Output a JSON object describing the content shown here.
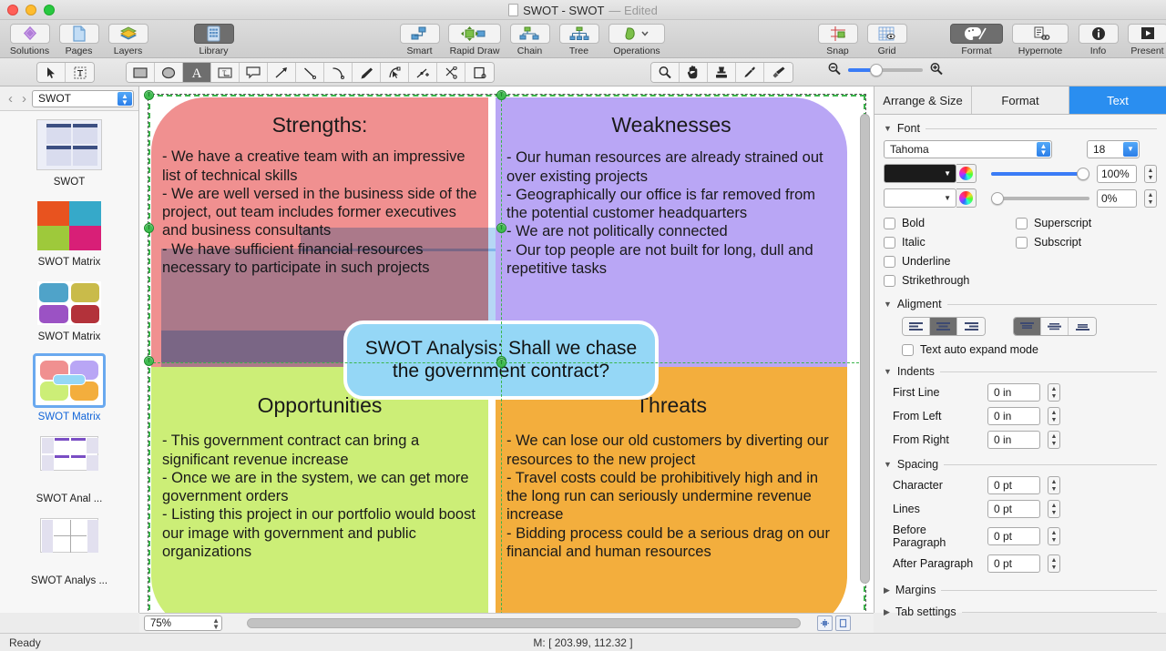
{
  "window": {
    "title": "SWOT - SWOT",
    "edited_label": "— Edited",
    "doc_icon": "document-icon"
  },
  "toolbar": {
    "left_group": [
      {
        "label": "Solutions",
        "icon": "solutions-diamond-icon",
        "selected": false
      },
      {
        "label": "Pages",
        "icon": "pages-icon",
        "selected": false
      },
      {
        "label": "Layers",
        "icon": "layers-icon",
        "selected": false
      }
    ],
    "library_group": [
      {
        "label": "Library",
        "icon": "library-grid-icon",
        "selected": true
      }
    ],
    "draw_group": [
      {
        "label": "Smart",
        "icon": "smart-connector-icon",
        "selected": false
      },
      {
        "label": "Rapid Draw",
        "icon": "rapid-draw-icon",
        "selected": false
      },
      {
        "label": "Chain",
        "icon": "chain-icon",
        "selected": false
      },
      {
        "label": "Tree",
        "icon": "tree-icon",
        "selected": false
      },
      {
        "label": "Operations",
        "icon": "operations-shape-icon",
        "selected": false
      }
    ],
    "view_group": [
      {
        "label": "Snap",
        "icon": "snap-icon",
        "selected": false
      },
      {
        "label": "Grid",
        "icon": "grid-icon",
        "selected": false
      }
    ],
    "right_group": [
      {
        "label": "Format",
        "icon": "format-palette-icon",
        "selected": true
      },
      {
        "label": "Hypernote",
        "icon": "hypernote-icon",
        "selected": false
      },
      {
        "label": "Info",
        "icon": "info-icon",
        "selected": false
      },
      {
        "label": "Present",
        "icon": "present-play-icon",
        "selected": false
      }
    ]
  },
  "toolstrip": {
    "select_tools": [
      {
        "icon": "pointer-arrow-icon",
        "selected": false
      },
      {
        "icon": "text-select-icon",
        "selected": false
      }
    ],
    "shape_tools": [
      {
        "icon": "rectangle-icon",
        "selected": false
      },
      {
        "icon": "ellipse-icon",
        "selected": false
      },
      {
        "icon": "text-tool-icon",
        "selected": true
      },
      {
        "icon": "text-field-icon",
        "selected": false
      },
      {
        "icon": "callout-icon",
        "selected": false
      },
      {
        "icon": "arrow-line-icon",
        "selected": false
      },
      {
        "icon": "line-icon",
        "selected": false
      },
      {
        "icon": "curve-icon",
        "selected": false
      },
      {
        "icon": "pen-icon",
        "selected": false
      },
      {
        "icon": "bezier-edit-icon",
        "selected": false
      },
      {
        "icon": "add-point-icon",
        "selected": false
      },
      {
        "icon": "scissors-cut-icon",
        "selected": false
      },
      {
        "icon": "crop-icon",
        "selected": false
      }
    ],
    "view_tools": [
      {
        "icon": "magnifier-icon",
        "selected": false
      },
      {
        "icon": "hand-pan-icon",
        "selected": false
      },
      {
        "icon": "stamp-icon",
        "selected": false
      },
      {
        "icon": "eyedropper-icon",
        "selected": false
      },
      {
        "icon": "paintbrush-icon",
        "selected": false
      }
    ],
    "zoom": {
      "out_icon": "zoom-out-icon",
      "in_icon": "zoom-in-icon",
      "value": 30
    }
  },
  "sidebar": {
    "prev_icon": "chevron-left-icon",
    "next_icon": "chevron-right-icon",
    "page_select_value": "SWOT",
    "pages": [
      {
        "label": "SWOT",
        "thumb": "swot-table-thumb",
        "active": false
      },
      {
        "label": "SWOT Matrix",
        "thumb": "swot-arrow-matrix-thumb",
        "active": false
      },
      {
        "label": "SWOT Matrix",
        "thumb": "swot-rounded-matrix-thumb",
        "active": false
      },
      {
        "label": "SWOT Matrix",
        "thumb": "swot-pastel-matrix-thumb",
        "active": true
      },
      {
        "label": "SWOT Anal ...",
        "thumb": "swot-analysis-grid-thumb",
        "active": false
      },
      {
        "label": "SWOT Analys ...",
        "thumb": "swot-analysis-table-thumb",
        "active": false
      }
    ]
  },
  "canvas": {
    "quadrants": [
      {
        "name": "strengths",
        "title": "Strengths:",
        "color": "#F09090",
        "selected_text": true,
        "body": "- We have a creative team with an impressive list of technical skills\n- We are well versed in the business side of the project, out team includes former executives and business consultants\n- We have sufficient financial resources necessary to participate in such projects"
      },
      {
        "name": "weaknesses",
        "title": "Weaknesses",
        "color": "#B9A6F5",
        "selected_text": false,
        "body": "- Our human resources are already strained out over existing projects\n- Geographically our office is far removed from the potential customer headquarters\n- We are not politically connected\n- Our top people are not built for long, dull and repetitive tasks"
      },
      {
        "name": "opportunities",
        "title": "Opportunities",
        "color": "#CCEE77",
        "selected_text": false,
        "body": "- This government contract can bring a significant revenue increase\n- Once we are in the system, we can get more government orders\n- Listing this project in our portfolio would boost our image with government and public organizations"
      },
      {
        "name": "threats",
        "title": "Threats",
        "color": "#F3AE3D",
        "selected_text": false,
        "body": "- We can lose our old customers by diverting our resources to the new project\n- Travel costs could be prohibitively high and in the long run can seriously undermine revenue increase\n- Bidding process could be a serious drag on our financial and human resources"
      }
    ],
    "callout": {
      "text": "SWOT Analysis: Shall we chase the government contract?",
      "color": "#95D7F6"
    },
    "selection_handle_color": "#3FBB4F",
    "text_highlight_color": "#B6D7F5"
  },
  "canvas_bar": {
    "zoom_value": "75%",
    "fit_icon": "fit-page-icon",
    "actual_size_icon": "actual-size-icon"
  },
  "inspector": {
    "tabs": [
      {
        "label": "Arrange & Size",
        "active": false
      },
      {
        "label": "Format",
        "active": false
      },
      {
        "label": "Text",
        "active": true
      }
    ],
    "font": {
      "section_title": "Font",
      "family": "Tahoma",
      "size": "18",
      "text_color": "#1b1b1b",
      "fill_color": "#ffffff",
      "opacity_text": "100%",
      "opacity_fill": "0%",
      "checkboxes_left": [
        {
          "label": "Bold",
          "checked": false
        },
        {
          "label": "Italic",
          "checked": false
        },
        {
          "label": "Underline",
          "checked": false
        },
        {
          "label": "Strikethrough",
          "checked": false
        }
      ],
      "checkboxes_right": [
        {
          "label": "Superscript",
          "checked": false
        },
        {
          "label": "Subscript",
          "checked": false
        }
      ]
    },
    "alignment": {
      "section_title": "Aligment",
      "horizontal": [
        {
          "icon": "align-left-icon",
          "selected": false
        },
        {
          "icon": "align-center-icon",
          "selected": true
        },
        {
          "icon": "align-right-icon",
          "selected": false
        }
      ],
      "vertical": [
        {
          "icon": "align-top-icon",
          "selected": true
        },
        {
          "icon": "align-middle-icon",
          "selected": false
        },
        {
          "icon": "align-bottom-icon",
          "selected": false
        }
      ],
      "auto_expand": {
        "label": "Text auto expand mode",
        "checked": false
      }
    },
    "indents": {
      "section_title": "Indents",
      "rows": [
        {
          "label": "First Line",
          "value": "0 in"
        },
        {
          "label": "From Left",
          "value": "0 in"
        },
        {
          "label": "From Right",
          "value": "0 in"
        }
      ]
    },
    "spacing": {
      "section_title": "Spacing",
      "rows": [
        {
          "label": "Character",
          "value": "0 pt"
        },
        {
          "label": "Lines",
          "value": "0 pt"
        },
        {
          "label": "Before Paragraph",
          "value": "0 pt"
        },
        {
          "label": "After Paragraph",
          "value": "0 pt"
        }
      ]
    },
    "collapsed": [
      {
        "label": "Margins"
      },
      {
        "label": "Tab settings"
      }
    ]
  },
  "status": {
    "ready": "Ready",
    "coords": "M: [ 203.99, 112.32 ]"
  }
}
